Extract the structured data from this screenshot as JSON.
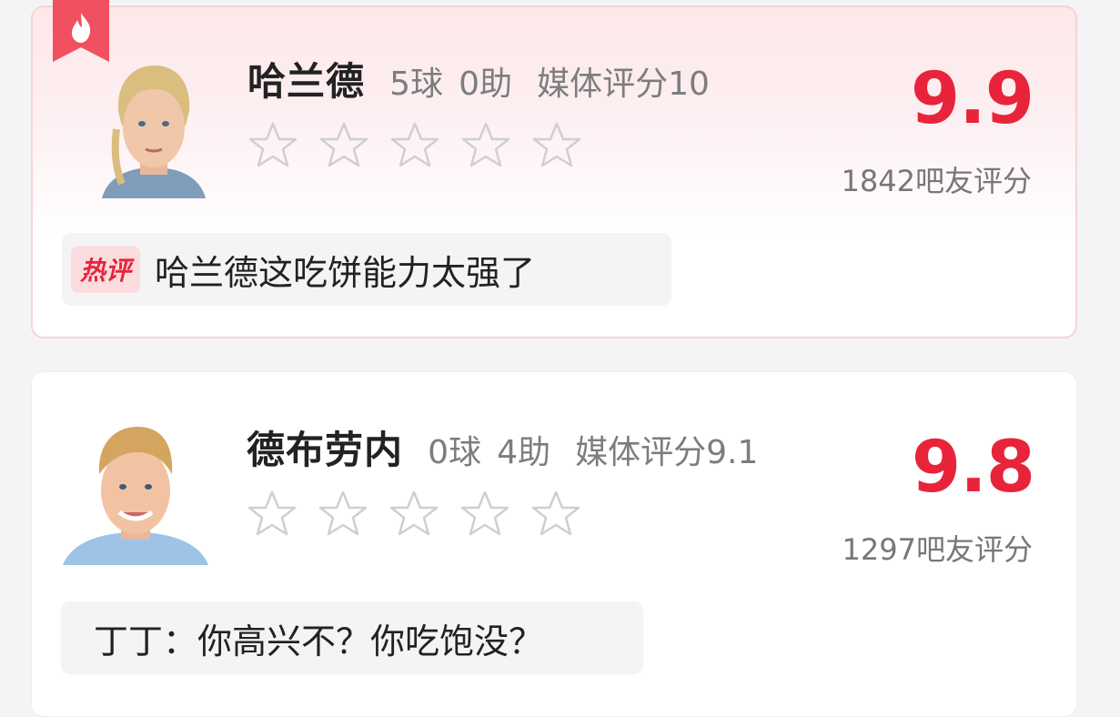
{
  "players": [
    {
      "name": "哈兰德",
      "goals": "5球",
      "assists": "0助",
      "media_rating": "媒体评分10",
      "score": "9.9",
      "fan_count": "1842吧友评分",
      "comment_tag": "热评",
      "comment": "哈兰德这吃饼能力太强了",
      "stars_filled": 0,
      "stars_total": 5,
      "hot_badge_icon": "flame-icon"
    },
    {
      "name": "德布劳内",
      "goals": "0球",
      "assists": "4助",
      "media_rating": "媒体评分9.1",
      "score": "9.8",
      "fan_count": "1297吧友评分",
      "comment": "丁丁：你高兴不？你吃饱没？",
      "stars_filled": 0,
      "stars_total": 5
    }
  ],
  "colors": {
    "accent": "#e8243b",
    "hot_card_bg": "#fde7ea",
    "comment_bg": "#f4f4f5"
  }
}
